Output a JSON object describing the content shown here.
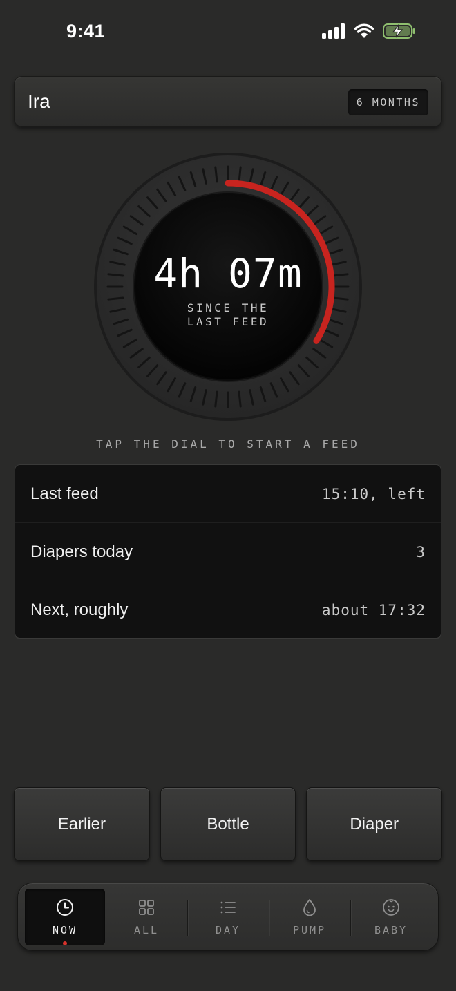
{
  "status_bar": {
    "time": "9:41",
    "icons": [
      "cellular-signal-icon",
      "wifi-icon",
      "battery-charging-icon"
    ]
  },
  "header": {
    "baby_name": "Ira",
    "age_badge": "6 MONTHS"
  },
  "dial": {
    "elapsed": "4h 07m",
    "caption_line1": "SINCE THE",
    "caption_line2": "LAST FEED",
    "accent_color": "#c8241f",
    "hint": "TAP THE DIAL TO START A FEED"
  },
  "stats": [
    {
      "label": "Last feed",
      "value": "15:10, left"
    },
    {
      "label": "Diapers today",
      "value": "3"
    },
    {
      "label": "Next, roughly",
      "value": "about 17:32"
    }
  ],
  "actions": [
    "Earlier",
    "Bottle",
    "Diaper"
  ],
  "tabs": [
    {
      "label": "NOW",
      "icon": "clock-icon",
      "active": true
    },
    {
      "label": "ALL",
      "icon": "grid-icon",
      "active": false
    },
    {
      "label": "DAY",
      "icon": "list-icon",
      "active": false
    },
    {
      "label": "PUMP",
      "icon": "drop-icon",
      "active": false
    },
    {
      "label": "BABY",
      "icon": "baby-face-icon",
      "active": false
    }
  ]
}
